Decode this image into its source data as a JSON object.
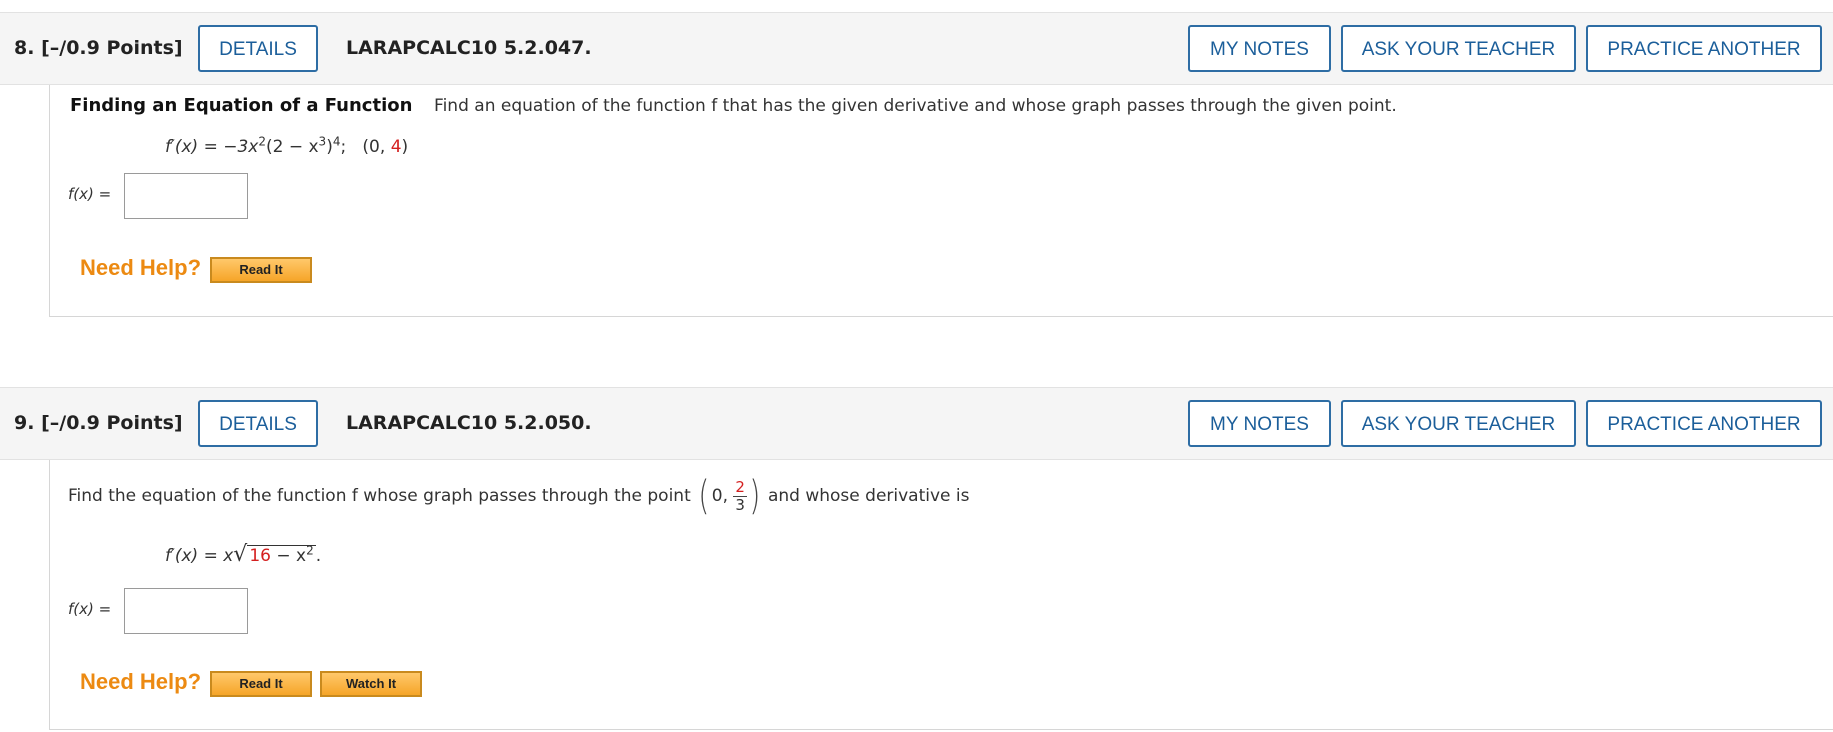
{
  "q8": {
    "number": "8.",
    "points": "[–/0.9 Points]",
    "details_label": "DETAILS",
    "code": "LARAPCALC10 5.2.047.",
    "my_notes_label": "MY NOTES",
    "ask_teacher_label": "ASK YOUR TEACHER",
    "practice_label": "PRACTICE ANOTHER",
    "heading": "Finding an Equation of a Function",
    "instruction": "Find an equation of the function f that has the given derivative and whose graph passes through the given point.",
    "equation_lhs": "f′(x) = −3x",
    "eq_exp1": "2",
    "eq_mid": "(2 − x",
    "eq_exp2": "3",
    "eq_close": ")",
    "eq_exp3": "4",
    "eq_sep": ";",
    "point_open": "(0, ",
    "point_y": "4",
    "point_close": ")",
    "answer_label": "f(x) =",
    "answer_value": "",
    "need_help": "Need Help?",
    "read_it": "Read It"
  },
  "q9": {
    "number": "9.",
    "points": "[–/0.9 Points]",
    "details_label": "DETAILS",
    "code": "LARAPCALC10 5.2.050.",
    "my_notes_label": "MY NOTES",
    "ask_teacher_label": "ASK YOUR TEACHER",
    "practice_label": "PRACTICE ANOTHER",
    "instruction_pre": "Find the equation of the function f whose graph passes through the point",
    "point_x": "0,",
    "point_num": "2",
    "point_den": "3",
    "instruction_post": "and whose derivative is",
    "deriv_lhs": "f′(x) = x",
    "sqrt_red": "16",
    "sqrt_rest": " − x",
    "sqrt_exp": "2",
    "deriv_end": ".",
    "answer_label": "f(x) =",
    "answer_value": "",
    "need_help": "Need Help?",
    "read_it": "Read It",
    "watch_it": "Watch It"
  }
}
